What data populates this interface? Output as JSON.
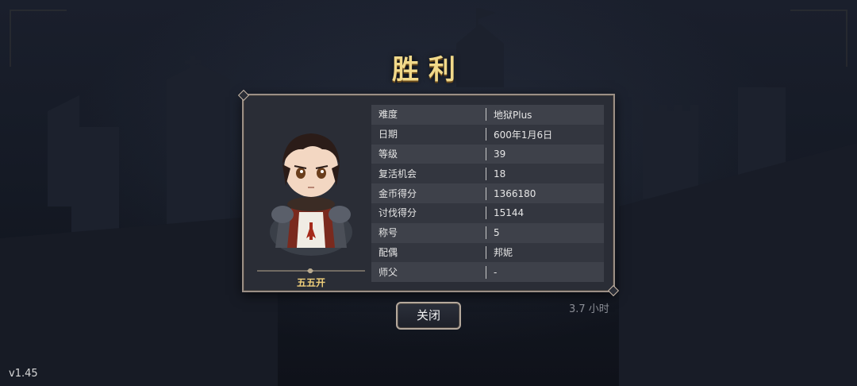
{
  "result_title": "胜利",
  "character": {
    "name": "五五开",
    "portrait": "knight-character-portrait"
  },
  "stats": [
    {
      "label": "难度",
      "value": "地狱Plus"
    },
    {
      "label": "日期",
      "value": "600年1月6日"
    },
    {
      "label": "等级",
      "value": "39"
    },
    {
      "label": "复活机会",
      "value": "18"
    },
    {
      "label": "金币得分",
      "value": "1366180"
    },
    {
      "label": "讨伐得分",
      "value": "15144"
    },
    {
      "label": "称号",
      "value": "5"
    },
    {
      "label": "配偶",
      "value": "邦妮"
    },
    {
      "label": "师父",
      "value": "-"
    }
  ],
  "close_button_label": "关闭",
  "play_time": "3.7 小时",
  "version": "v1.45",
  "colors": {
    "title": "#f1d98a",
    "panel": "#2a2d36",
    "name": "#f0cf7a"
  }
}
